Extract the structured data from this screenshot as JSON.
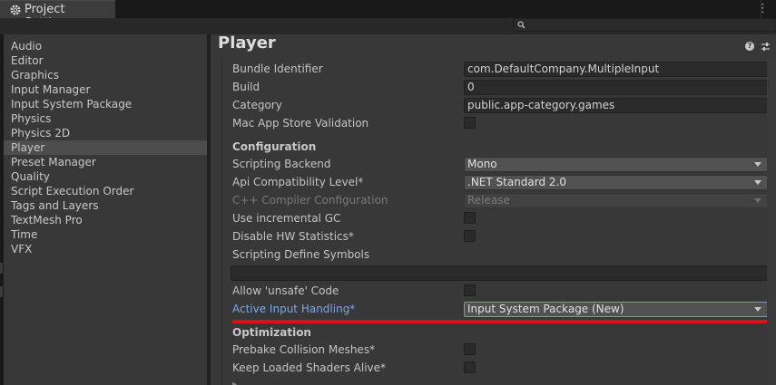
{
  "window": {
    "tab_title": "Project Settings",
    "menu_glyph": "⋮"
  },
  "sidebar": {
    "items": [
      {
        "label": "Audio"
      },
      {
        "label": "Editor"
      },
      {
        "label": "Graphics"
      },
      {
        "label": "Input Manager"
      },
      {
        "label": "Input System Package"
      },
      {
        "label": "Physics"
      },
      {
        "label": "Physics 2D"
      },
      {
        "label": "Player"
      },
      {
        "label": "Preset Manager"
      },
      {
        "label": "Quality"
      },
      {
        "label": "Script Execution Order"
      },
      {
        "label": "Tags and Layers"
      },
      {
        "label": "TextMesh Pro"
      },
      {
        "label": "Time"
      },
      {
        "label": "VFX"
      }
    ],
    "selected_index": 7
  },
  "main": {
    "title": "Player",
    "help_glyph": "?",
    "rows": {
      "bundle_identifier": {
        "label": "Bundle Identifier",
        "value": "com.DefaultCompany.MultipleInput"
      },
      "build": {
        "label": "Build",
        "value": "0"
      },
      "category": {
        "label": "Category",
        "value": "public.app-category.games"
      },
      "mac_app_store_validation": {
        "label": "Mac App Store Validation",
        "checked": false
      },
      "configuration_header": "Configuration",
      "scripting_backend": {
        "label": "Scripting Backend",
        "value": "Mono"
      },
      "api_compatibility": {
        "label": "Api Compatibility Level*",
        "value": ".NET Standard 2.0"
      },
      "cpp_compiler": {
        "label": "C++ Compiler Configuration",
        "value": "Release",
        "disabled": true
      },
      "incremental_gc": {
        "label": "Use incremental GC",
        "checked": false
      },
      "disable_hw_stats": {
        "label": "Disable HW Statistics*",
        "checked": false
      },
      "scripting_define": {
        "label": "Scripting Define Symbols",
        "value": ""
      },
      "allow_unsafe": {
        "label": "Allow 'unsafe' Code",
        "checked": false
      },
      "active_input": {
        "label": "Active Input Handling*",
        "value": "Input System Package (New)"
      },
      "optimization_header": "Optimization",
      "prebake_collision": {
        "label": "Prebake Collision Meshes*",
        "checked": false
      },
      "keep_shaders": {
        "label": "Keep Loaded Shaders Alive*",
        "checked": false
      }
    }
  },
  "colors": {
    "background": "#383838",
    "accent_link": "#7aa7e8",
    "highlight_underline": "#dd1111"
  }
}
